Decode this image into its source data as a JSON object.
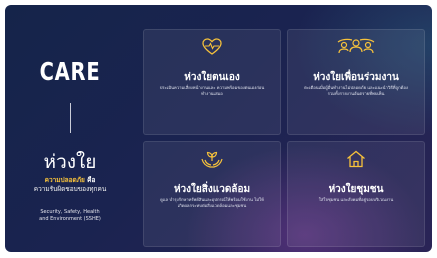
{
  "left": {
    "brand": "CARE",
    "title": "ห่วงใย",
    "subtitle_highlight": "ความปลอดภัย",
    "subtitle_rest": " คือ",
    "subtitle_line2": "ความรับผิดชอบของทุกคน",
    "english_line1": "Security, Safety, Health",
    "english_line2": "and Environment (SSHE)"
  },
  "cards": [
    {
      "icon": "heart-line-icon",
      "title": "ห่วงใยตนเอง",
      "desc": "ประเมินความเสี่ยงหน้างานและ ความพร้อมของตนเองก่อนทำงานเสมอ"
    },
    {
      "icon": "people-group-icon",
      "title": "ห่วงใยเพื่อนร่วมงาน",
      "desc": "ตะเตือนเมื่อผู้อื่นทำงานไม่ปลอดภัย และแนะนำวิธีที่ถูกต้อง รวมทั้งรายงานอันตรายที่พบเห็น"
    },
    {
      "icon": "hands-plant-icon",
      "title": "ห่วงใยสิ่งแวดล้อม",
      "desc": "ดูแล บำรุงรักษาทรัพย์สินและอุปกรณ์ให้พร้อมใช้งาน ไม่ให้เกิดผลกระทบต่อสิ่งแวดล้อมและชุมชน"
    },
    {
      "icon": "house-icon",
      "title": "ห่วงใยชุมชน",
      "desc": "ใส่ใจชุมชน และสังคมที่อยู่รอบบริเวณงาน"
    }
  ],
  "colors": {
    "background": "#1a2350",
    "accent": "#f7c23b"
  }
}
